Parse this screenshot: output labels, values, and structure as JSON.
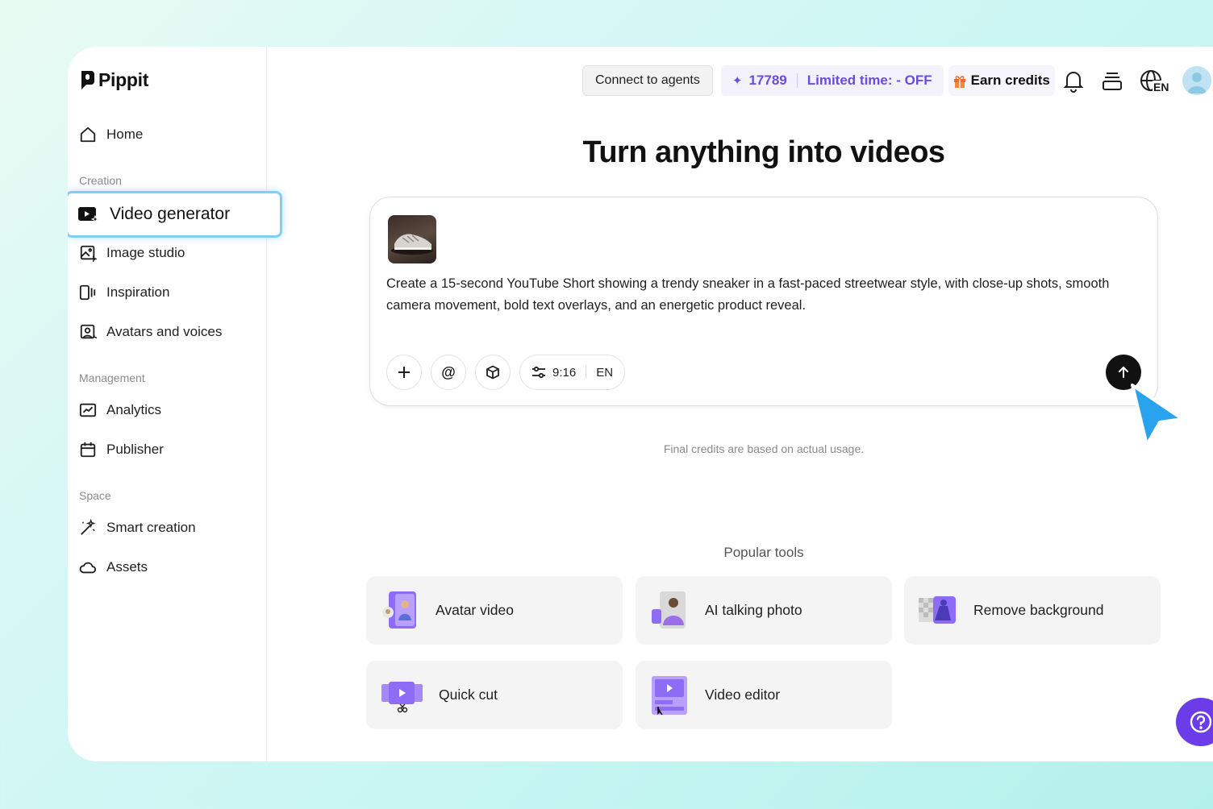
{
  "app": {
    "name": "Pippit"
  },
  "sidebar": {
    "home": "Home",
    "sections": {
      "creation": "Creation",
      "management": "Management",
      "space": "Space"
    },
    "creation_items": {
      "video_generator": "Video generator",
      "image_studio": "Image studio",
      "inspiration": "Inspiration",
      "avatars_voices": "Avatars and voices"
    },
    "management_items": {
      "analytics": "Analytics",
      "publisher": "Publisher"
    },
    "space_items": {
      "smart_creation": "Smart creation",
      "assets": "Assets"
    }
  },
  "topbar": {
    "connect_agents": "Connect to agents",
    "credits": "17789",
    "promo": "Limited time: - OFF",
    "earn_credits": "Earn credits",
    "language": "EN"
  },
  "main": {
    "title": "Turn anything into videos",
    "prompt": "Create a 15-second YouTube Short showing a trendy sneaker in a fast-paced streetwear style, with close-up shots, smooth camera movement, bold text overlays, and an energetic product reveal.",
    "aspect_ratio": "9:16",
    "language": "EN",
    "credits_note": "Final credits are based on actual usage.",
    "popular_label": "Popular tools",
    "tools": {
      "avatar_video": "Avatar video",
      "ai_talking_photo": "AI talking photo",
      "remove_background": "Remove background",
      "quick_cut": "Quick cut",
      "video_editor": "Video editor"
    }
  },
  "colors": {
    "accent": "#6a4ce0",
    "active_border": "#7ed0f2",
    "cursor": "#2aa3ee",
    "help_button": "#6c3ce9"
  }
}
